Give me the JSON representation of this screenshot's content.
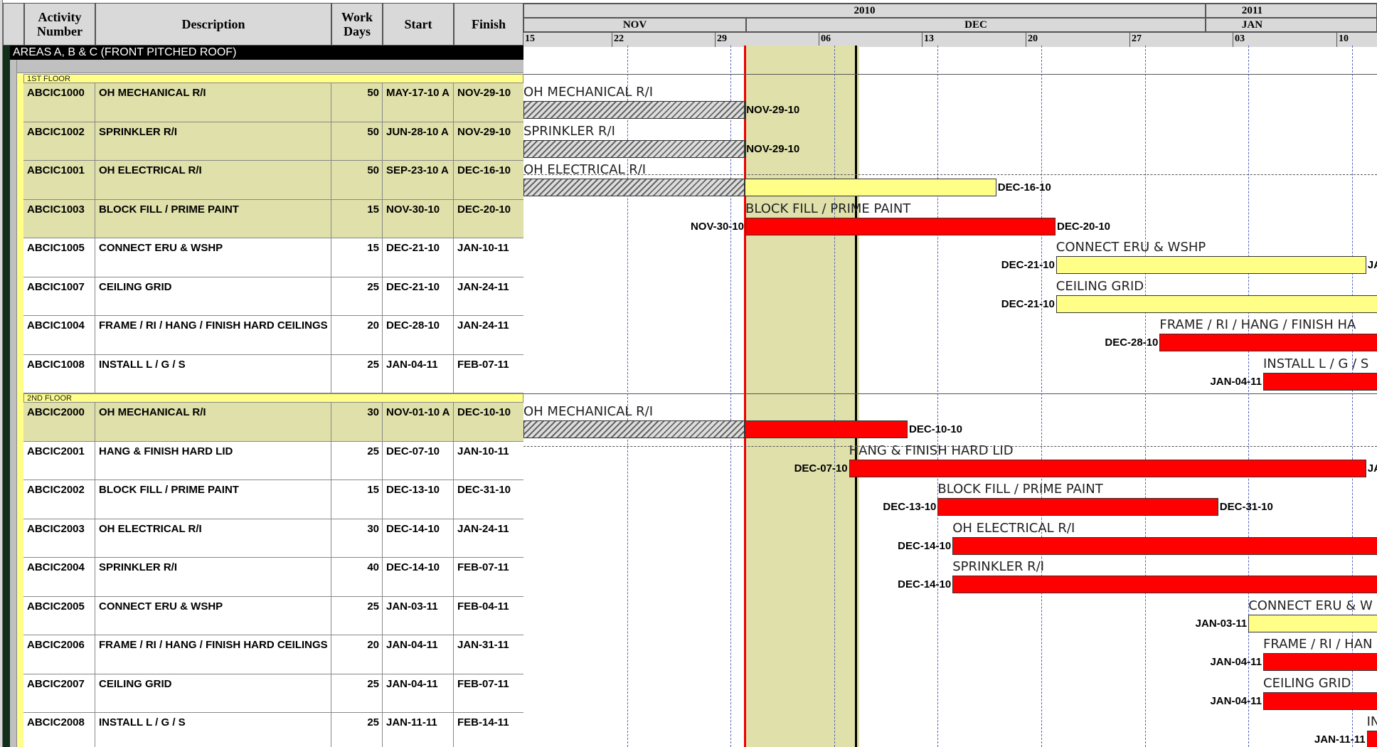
{
  "table_header": {
    "activity_number": "Activity Number",
    "description": "Description",
    "work_days": "Work Days",
    "start": "Start",
    "finish": "Finish"
  },
  "timescale": {
    "years": [
      "2010",
      "2011"
    ],
    "months": [
      "NOV",
      "DEC",
      "JAN"
    ],
    "weeks": [
      "15",
      "22",
      "29",
      "06",
      "13",
      "20",
      "27",
      "03",
      "10"
    ]
  },
  "band_title": "AREAS A, B & C (FRONT PITCHED ROOF)",
  "groups": [
    {
      "label": "1ST FLOOR",
      "activities": [
        {
          "id": "ABCIC1000",
          "desc": "OH MECHANICAL R/I",
          "days": "50",
          "start": "MAY-17-10 A",
          "finish": "NOV-29-10",
          "bar_label": "OH MECHANICAL R/I",
          "start_label": "",
          "finish_label": "NOV-29-10",
          "progress": "actual"
        },
        {
          "id": "ABCIC1002",
          "desc": "SPRINKLER R/I",
          "days": "50",
          "start": "JUN-28-10 A",
          "finish": "NOV-29-10",
          "bar_label": "SPRINKLER R/I",
          "start_label": "",
          "finish_label": "NOV-29-10",
          "progress": "actual"
        },
        {
          "id": "ABCIC1001",
          "desc": "OH ELECTRICAL R/I",
          "days": "50",
          "start": "SEP-23-10 A",
          "finish": "DEC-16-10",
          "bar_label": "OH ELECTRICAL R/I",
          "start_label": "",
          "finish_label": "DEC-16-10",
          "progress": "actual"
        },
        {
          "id": "ABCIC1003",
          "desc": "BLOCK FILL  / PRIME PAINT",
          "days": "15",
          "start": "NOV-30-10",
          "finish": "DEC-20-10",
          "bar_label": "BLOCK FILL  / PRIME PAINT",
          "start_label": "NOV-30-10",
          "finish_label": "DEC-20-10",
          "progress": "critical"
        },
        {
          "id": "ABCIC1005",
          "desc": "CONNECT ERU & WSHP",
          "days": "15",
          "start": "DEC-21-10",
          "finish": "JAN-10-11",
          "bar_label": "CONNECT ERU & WSHP",
          "start_label": "DEC-21-10",
          "finish_label": "JAN",
          "progress": "noncritical"
        },
        {
          "id": "ABCIC1007",
          "desc": "CEILING GRID",
          "days": "25",
          "start": "DEC-21-10",
          "finish": "JAN-24-11",
          "bar_label": "CEILING GRID",
          "start_label": "DEC-21-10",
          "finish_label": "",
          "progress": "noncritical"
        },
        {
          "id": "ABCIC1004",
          "desc": "FRAME  / RI / HANG / FINISH HARD CEILINGS",
          "days": "20",
          "start": "DEC-28-10",
          "finish": "JAN-24-11",
          "bar_label": "FRAME  / RI / HANG / FINISH HA",
          "start_label": "DEC-28-10",
          "finish_label": "",
          "progress": "critical"
        },
        {
          "id": "ABCIC1008",
          "desc": "INSTALL L / G / S",
          "days": "25",
          "start": "JAN-04-11",
          "finish": "FEB-07-11",
          "bar_label": "INSTALL L / G / S",
          "start_label": "JAN-04-11",
          "finish_label": "",
          "progress": "critical"
        }
      ]
    },
    {
      "label": "2ND FLOOR",
      "activities": [
        {
          "id": "ABCIC2000",
          "desc": "OH MECHANICAL R/I",
          "days": "30",
          "start": "NOV-01-10 A",
          "finish": "DEC-10-10",
          "bar_label": "OH MECHANICAL R/I",
          "start_label": "",
          "finish_label": "DEC-10-10",
          "progress": "actual"
        },
        {
          "id": "ABCIC2001",
          "desc": "HANG & FINISH HARD LID",
          "days": "25",
          "start": "DEC-07-10",
          "finish": "JAN-10-11",
          "bar_label": "HANG & FINISH HARD LID",
          "start_label": "DEC-07-10",
          "finish_label": "JAN",
          "progress": "critical"
        },
        {
          "id": "ABCIC2002",
          "desc": "BLOCK FILL  / PRIME PAINT",
          "days": "15",
          "start": "DEC-13-10",
          "finish": "DEC-31-10",
          "bar_label": "BLOCK FILL  / PRIME PAINT",
          "start_label": "DEC-13-10",
          "finish_label": "DEC-31-10",
          "progress": "critical"
        },
        {
          "id": "ABCIC2003",
          "desc": "OH ELECTRICAL R/I",
          "days": "30",
          "start": "DEC-14-10",
          "finish": "JAN-24-11",
          "bar_label": "OH ELECTRICAL R/I",
          "start_label": "DEC-14-10",
          "finish_label": "",
          "progress": "critical"
        },
        {
          "id": "ABCIC2004",
          "desc": "SPRINKLER R/I",
          "days": "40",
          "start": "DEC-14-10",
          "finish": "FEB-07-11",
          "bar_label": "SPRINKLER R/I",
          "start_label": "DEC-14-10",
          "finish_label": "",
          "progress": "critical"
        },
        {
          "id": "ABCIC2005",
          "desc": "CONNECT ERU & WSHP",
          "days": "25",
          "start": "JAN-03-11",
          "finish": "FEB-04-11",
          "bar_label": "CONNECT ERU & W",
          "start_label": "JAN-03-11",
          "finish_label": "",
          "progress": "noncritical"
        },
        {
          "id": "ABCIC2006",
          "desc": "FRAME  / RI / HANG / FINISH HARD CEILINGS",
          "days": "20",
          "start": "JAN-04-11",
          "finish": "JAN-31-11",
          "bar_label": "FRAME  / RI / HAN",
          "start_label": "JAN-04-11",
          "finish_label": "",
          "progress": "critical"
        },
        {
          "id": "ABCIC2007",
          "desc": "CEILING GRID",
          "days": "25",
          "start": "JAN-04-11",
          "finish": "FEB-07-11",
          "bar_label": "CEILING GRID",
          "start_label": "JAN-04-11",
          "finish_label": "",
          "progress": "critical"
        },
        {
          "id": "ABCIC2008",
          "desc": "INSTALL L / G / S",
          "days": "25",
          "start": "JAN-11-11",
          "finish": "FEB-14-11",
          "bar_label": "INS",
          "start_label": "JAN-11-11",
          "finish_label": "",
          "progress": "critical"
        }
      ]
    }
  ],
  "colors": {
    "critical_bar": "#ff0000",
    "noncritical_bar": "#ffff88",
    "group_bar": "#ffff88",
    "shaded_period": "#dfe0aa",
    "data_date_line": "#ee0000"
  }
}
